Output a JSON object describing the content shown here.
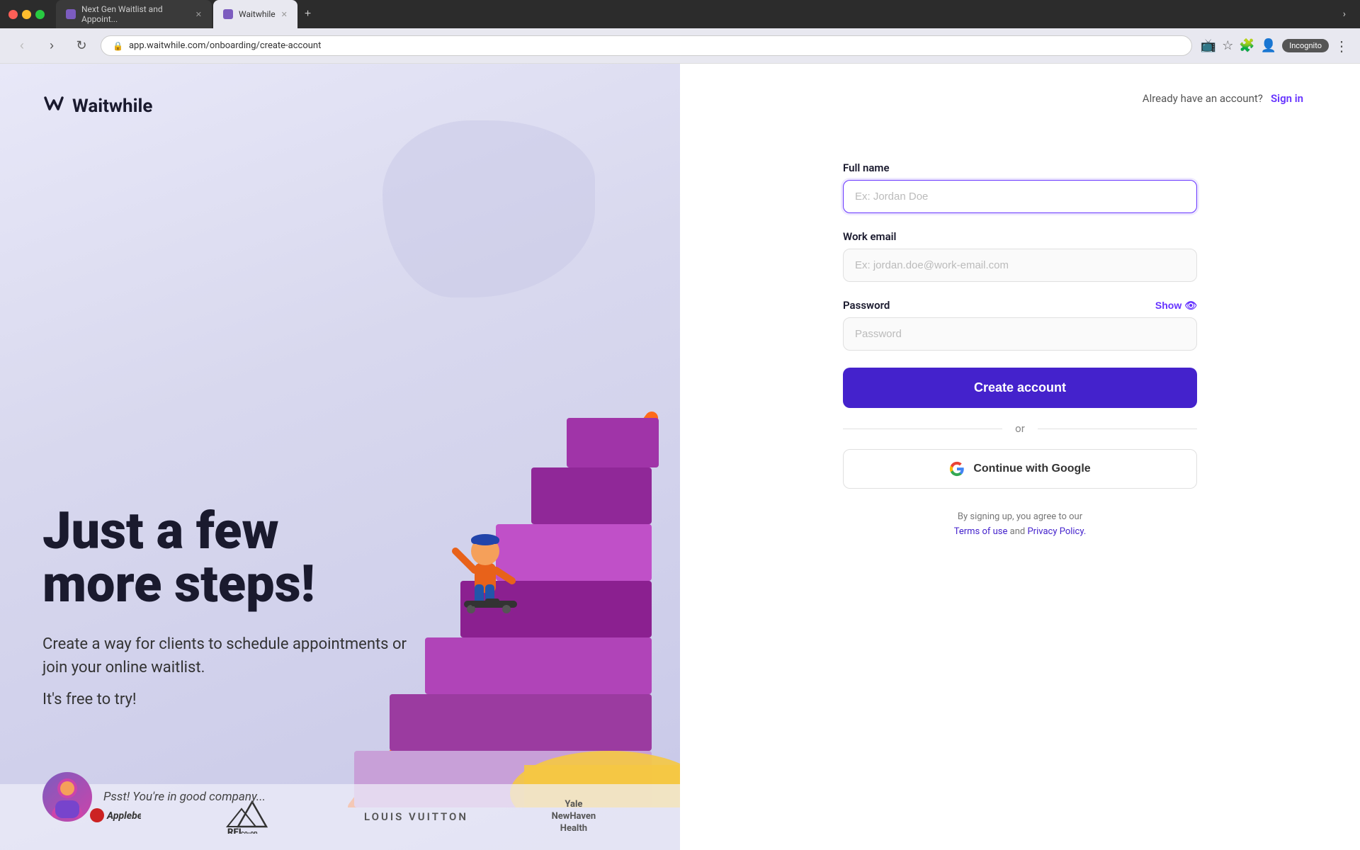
{
  "browser": {
    "tabs": [
      {
        "label": "Next Gen Waitlist and Appoint...",
        "active": false,
        "favicon_color": "#7c5cbf"
      },
      {
        "label": "Waitwhile",
        "active": true,
        "favicon_color": "#7c5cbf"
      }
    ],
    "url": "app.waitwhile.com/onboarding/create-account",
    "incognito_label": "Incognito",
    "new_tab_btn": "+"
  },
  "left_panel": {
    "logo_text": "Waitwhile",
    "logo_icon": "W",
    "hero_heading": "Just a few\nmore steps!",
    "hero_subtext": "Create a way for clients to schedule appointments or join your online waitlist.",
    "hero_free": "It's free to try!",
    "social_proof_text": "Psst! You're in good company..."
  },
  "right_panel": {
    "already_account_text": "Already have an account?",
    "sign_in_label": "Sign in",
    "full_name_label": "Full name",
    "full_name_placeholder": "Ex: Jordan Doe",
    "work_email_label": "Work email",
    "work_email_placeholder": "Ex: jordan.doe@work-email.com",
    "password_label": "Password",
    "password_placeholder": "Password",
    "show_label": "Show",
    "create_account_label": "Create account",
    "or_label": "or",
    "google_btn_label": "Continue with Google",
    "terms_text_1": "By signing up, you agree to our",
    "terms_of_use": "Terms of use",
    "terms_and": "and",
    "privacy_policy": "Privacy Policy."
  },
  "brands": [
    {
      "name": "Applebee's",
      "style": "applebees"
    },
    {
      "name": "REI\nco-op",
      "style": "rei"
    },
    {
      "name": "LOUIS VUITTON",
      "style": "lv"
    },
    {
      "name": "Yale\nNewHaven\nHealth",
      "style": "yale"
    }
  ]
}
